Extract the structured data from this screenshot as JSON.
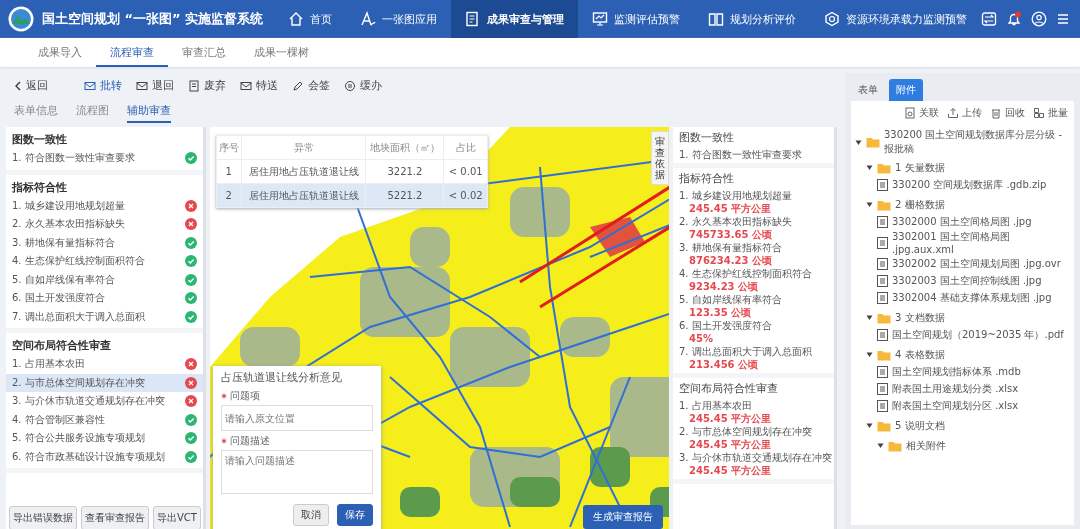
{
  "header": {
    "title": "国土空间规划 “一张图” 实施监督系统",
    "nav": [
      {
        "label": "首页",
        "selected": false
      },
      {
        "label": "一张图应用",
        "selected": false
      },
      {
        "label": "成果审查与管理",
        "selected": true
      },
      {
        "label": "监测评估预警",
        "selected": false
      },
      {
        "label": "规划分析评价",
        "selected": false
      },
      {
        "label": "资源环境承载力监测预警",
        "selected": false
      }
    ]
  },
  "subnav": [
    {
      "label": "成果导入",
      "selected": false
    },
    {
      "label": "流程审查",
      "selected": true
    },
    {
      "label": "审查汇总",
      "selected": false
    },
    {
      "label": "成果一棵树",
      "selected": false
    }
  ],
  "toolbar": {
    "back": "返回",
    "actions": [
      {
        "label": "批转",
        "primary": true
      },
      {
        "label": "退回",
        "primary": false
      },
      {
        "label": "废弃",
        "primary": false
      },
      {
        "label": "特送",
        "primary": false
      },
      {
        "label": "会签",
        "primary": false
      },
      {
        "label": "缓办",
        "primary": false
      }
    ]
  },
  "view_tabs": [
    {
      "label": "表单信息",
      "selected": false
    },
    {
      "label": "流程图",
      "selected": false
    },
    {
      "label": "辅助审查",
      "selected": true
    }
  ],
  "checklist": {
    "groups": [
      {
        "title": "图数一致性",
        "items": [
          {
            "label": "1. 符合图数一致性审查要求",
            "passed": true,
            "selected": false
          }
        ]
      },
      {
        "title": "指标符合性",
        "items": [
          {
            "label": "1. 城乡建设用地规划超量",
            "passed": false,
            "selected": false
          },
          {
            "label": "2. 永久基本农田指标缺失",
            "passed": false,
            "selected": false
          },
          {
            "label": "3. 耕地保有量指标符合",
            "passed": true,
            "selected": false
          },
          {
            "label": "4. 生态保护红线控制面积符合",
            "passed": true,
            "selected": false
          },
          {
            "label": "5. 自如岸线保有率符合",
            "passed": true,
            "selected": false
          },
          {
            "label": "6. 国土开发强度符合",
            "passed": true,
            "selected": false
          },
          {
            "label": "7. 调出总面积大于调入总面积",
            "passed": true,
            "selected": false
          }
        ]
      },
      {
        "title": "空间布局符合性审查",
        "items": [
          {
            "label": "1. 占用基本农田",
            "passed": false,
            "selected": false
          },
          {
            "label": "2. 与市总体空间规划存在冲突",
            "passed": false,
            "selected": true
          },
          {
            "label": "3. 与介休市轨道交通规划存在冲突",
            "passed": false,
            "selected": false
          },
          {
            "label": "4. 符合管制区兼容性",
            "passed": true,
            "selected": false
          },
          {
            "label": "5. 符合公共服务设施专项规划",
            "passed": true,
            "selected": false
          },
          {
            "label": "6. 符合市政基础设计设施专项规划",
            "passed": true,
            "selected": false
          }
        ]
      }
    ],
    "buttons": [
      "导出错误数据",
      "查看审查报告",
      "导出VCT"
    ]
  },
  "map": {
    "table": {
      "columns": [
        "序号",
        "异常",
        "地块面积（㎡）",
        "占比"
      ],
      "rows": [
        {
          "cells": [
            "1",
            "居住用地占压轨道退让线",
            "3221.2",
            "< 0.01"
          ],
          "selected": false
        },
        {
          "cells": [
            "2",
            "居住用地占压轨道退让线",
            "5221.2",
            "< 0.02"
          ],
          "selected": true
        }
      ]
    },
    "side_tab": "审查依据",
    "dialog": {
      "title": "占压轨道退让线分析意见",
      "fields": [
        {
          "label": "问题项",
          "placeholder": "请输入原文位置",
          "required": true,
          "kind": "input"
        },
        {
          "label": "问题描述",
          "placeholder": "请输入问题描述",
          "required": true,
          "kind": "textarea"
        }
      ],
      "cancel": "取消",
      "save": "保存"
    },
    "report_button": "生成审查报告"
  },
  "results": {
    "groups": [
      {
        "title": "图数一致性",
        "items": [
          {
            "label": "1. 符合图数一致性审查要求"
          }
        ]
      },
      {
        "title": "指标符合性",
        "items": [
          {
            "label": "1. 城乡建设用地规划超量",
            "value": "245.45 平方公里"
          },
          {
            "label": "2. 永久基本农田指标缺失",
            "value": "745733.65 公顷"
          },
          {
            "label": "3. 耕地保有量指标符合",
            "value": "876234.23 公顷"
          },
          {
            "label": "4. 生态保护红线控制面积符合",
            "value": "9234.23 公顷"
          },
          {
            "label": "5. 自如岸线保有率符合",
            "value": "123.35 公顷"
          },
          {
            "label": "6. 国土开发强度符合",
            "value": "45%"
          },
          {
            "label": "7. 调出总面积大于调入总面积",
            "value": "213.456 公顷"
          }
        ]
      },
      {
        "title": "空间布局符合性审查",
        "items": [
          {
            "label": "1. 占用基本农田",
            "value": "245.45 平方公里"
          },
          {
            "label": "2. 与市总体空间规划存在冲突",
            "value": "245.45 平方公里"
          },
          {
            "label": "3. 与介休市轨道交通规划存在冲突",
            "value": "245.45 平方公里"
          }
        ]
      }
    ]
  },
  "attachments": {
    "tabs": [
      {
        "label": "表单",
        "selected": false
      },
      {
        "label": "附件",
        "selected": true
      }
    ],
    "actions": [
      "关联",
      "上传",
      "回收",
      "批量"
    ],
    "tree": [
      {
        "label": "330200 国土空间规划数据库分层分级 - 报批稿",
        "kind": "folder",
        "expanded": true,
        "children": [
          {
            "label": "1 矢量数据",
            "kind": "folder",
            "expanded": true,
            "children": [
              {
                "label": "330200 空间规划数据库 .gdb.zip",
                "kind": "file"
              }
            ]
          },
          {
            "label": "2 栅格数据",
            "kind": "folder",
            "expanded": true,
            "children": [
              {
                "label": "3302000 国土空间格局图 .jpg",
                "kind": "file"
              },
              {
                "label": "3302001 国土空间格局图 .jpg.aux.xml",
                "kind": "file"
              },
              {
                "label": "3302002 国土空间规划局图 .jpg.ovr",
                "kind": "file"
              },
              {
                "label": "3302003 国土空间控制线图 .jpg",
                "kind": "file"
              },
              {
                "label": "3302004 基础支撑体系规划图 .jpg",
                "kind": "file"
              }
            ]
          },
          {
            "label": "3 文档数据",
            "kind": "folder",
            "expanded": true,
            "children": [
              {
                "label": "国土空间规划（2019~2035 年）.pdf",
                "kind": "file"
              }
            ]
          },
          {
            "label": "4 表格数据",
            "kind": "folder",
            "expanded": true,
            "children": [
              {
                "label": "国土空间规划指标体系 .mdb",
                "kind": "file"
              },
              {
                "label": "附表国土用途规划分类 .xlsx",
                "kind": "file"
              },
              {
                "label": "附表国土空间规划分区 .xlsx",
                "kind": "file"
              }
            ]
          },
          {
            "label": "5 说明文档",
            "kind": "folder",
            "expanded": true,
            "children": [
              {
                "label": "相关附件",
                "kind": "folder",
                "expanded": true
              }
            ]
          }
        ]
      }
    ]
  }
}
